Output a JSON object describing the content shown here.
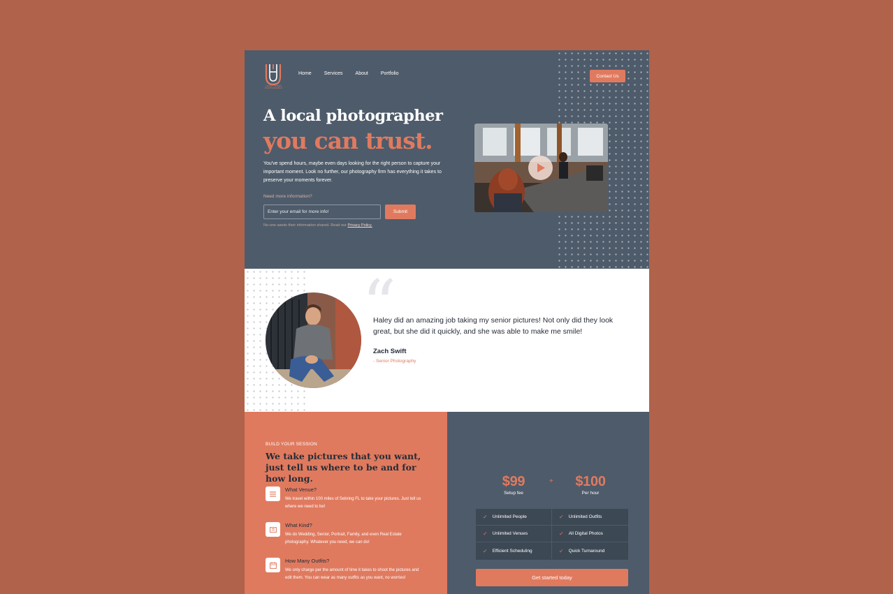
{
  "brand": {
    "logo_text": "HALEY SPENS PHOTOGRAPHY",
    "accent": "#e07a5f",
    "dark": "#4e5b6a",
    "background": "#b0624b"
  },
  "nav": {
    "items": [
      "Home",
      "Services",
      "About",
      "Portfolio"
    ],
    "contact_label": "Contact Us"
  },
  "hero": {
    "title_line1": "A local photographer",
    "title_line2": "you can trust.",
    "description": "You've spend hours, maybe even days looking for the right person to capture your important moment. Look no further, our photography firm has everything it takes to preserve your moments forever.",
    "info_prompt": "Need more information?",
    "email_placeholder": "Enter your email for more info!",
    "submit_label": "Submit",
    "privacy_prefix": "No-one wants their information shared. Read our ",
    "privacy_link": "Privacy Policy.",
    "video_icon": "play-icon"
  },
  "testimonial": {
    "quote_mark": "“",
    "quote": "Haley did an amazing job taking my senior pictures! Not only did they look great, but she did it quickly, and she was able to make me smile!",
    "author": "Zach Swift",
    "role": "- Senior Photography"
  },
  "build": {
    "eyebrow": "BUILD YOUR SESSION",
    "title": "We take pictures that you want, just tell us where to be and for how long.",
    "features": [
      {
        "icon": "list-icon",
        "title": "What Venue?",
        "description": "We travel within 100 miles of Sebring FL to take your pictures. Just tell us where we need to be!"
      },
      {
        "icon": "image-icon",
        "title": "What Kind?",
        "description": "We do Wedding, Senior, Portrait, Family, and even Real Estate photography. Whatever you need, we can do!"
      },
      {
        "icon": "calendar-icon",
        "title": "How Many Outfits?",
        "description": "We only charge per the amount of time it takes to shoot the pictures and edit them. You can wear as many outfits as you want, no worries!"
      }
    ]
  },
  "pricing": {
    "setup_price": "$99",
    "setup_label": "Setup fee",
    "plus": "+",
    "hourly_price": "$100",
    "hourly_label": "Per hour",
    "features": [
      "Unlimited People",
      "Unlimited Outfits",
      "Unlimited Venues",
      "All Digital Photos",
      "Efficient Scheduling",
      "Quick Turnaround"
    ],
    "cta_label": "Get started today"
  }
}
